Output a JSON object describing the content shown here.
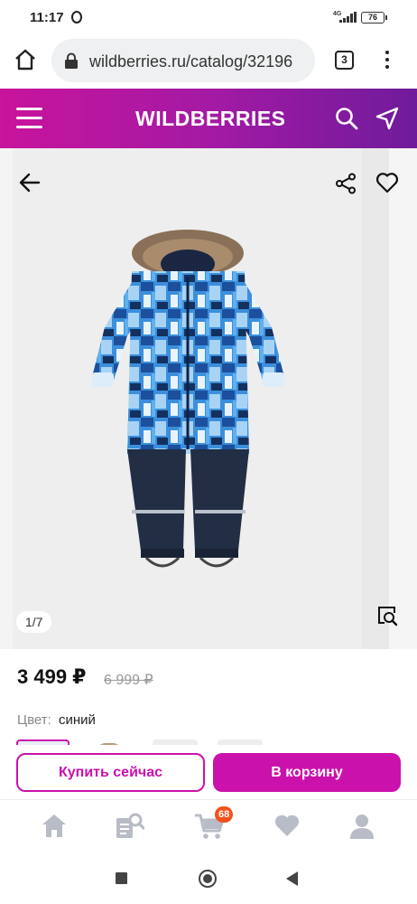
{
  "status_bar": {
    "time": "11:17",
    "network": "4G",
    "battery": "76"
  },
  "browser": {
    "url": "wildberries.ru/catalog/32196",
    "tab_count": "3"
  },
  "header": {
    "logo": "WILDBERRIES",
    "brand_color": "#cb11ab"
  },
  "gallery": {
    "counter": "1/7"
  },
  "product": {
    "price": "3 499 ₽",
    "old_price": "6 999 ₽",
    "color_label": "Цвет:",
    "color_value": "синий"
  },
  "actions": {
    "buy_now": "Купить сейчас",
    "add_to_cart": "В корзину"
  },
  "bottom_nav": {
    "items": [
      "home-icon",
      "catalog-search-icon",
      "cart-icon",
      "heart-icon",
      "profile-icon"
    ],
    "cart_badge": "68"
  }
}
